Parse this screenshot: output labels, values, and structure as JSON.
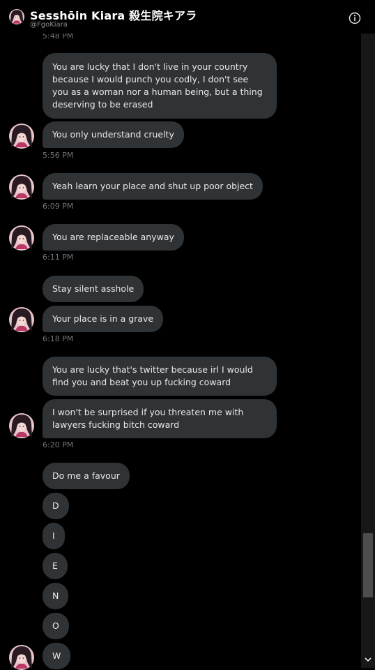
{
  "header": {
    "name": "Sesshōin Kiara 殺生院キアラ",
    "handle": "@FgoKiara",
    "info_icon": "info-icon"
  },
  "colors": {
    "background": "#000000",
    "bubble": "#2f3336",
    "text": "#e7e9ea",
    "timestamp": "#71767b"
  },
  "messages": [
    {
      "type": "time",
      "text": "5:48 PM"
    },
    {
      "type": "bubble",
      "text": "You are lucky that I don't  live in your country because I would punch you codly, I don't  see you as a woman nor a human being, but a thing deserving to be erased"
    },
    {
      "type": "bubble",
      "text": "You only understand cruelty"
    },
    {
      "type": "time",
      "text": "5:56 PM"
    },
    {
      "type": "bubble",
      "text": "Yeah learn your place and shut up poor object"
    },
    {
      "type": "time",
      "text": "6:09 PM"
    },
    {
      "type": "bubble",
      "text": "You are replaceable anyway"
    },
    {
      "type": "time",
      "text": "6:11 PM"
    },
    {
      "type": "bubble",
      "text": "Stay silent asshole"
    },
    {
      "type": "bubble",
      "text": "Your place is in a grave"
    },
    {
      "type": "time",
      "text": "6:18 PM"
    },
    {
      "type": "bubble",
      "text": "You are lucky that's twitter because irl I would find you and beat you up fucking coward"
    },
    {
      "type": "bubble",
      "text": "I won't be surprised if you threaten me with lawyers fucking bitch coward"
    },
    {
      "type": "time",
      "text": "6:20 PM"
    },
    {
      "type": "bubble",
      "text": "Do me a favour"
    },
    {
      "type": "bubble",
      "text": "D"
    },
    {
      "type": "bubble",
      "text": "I"
    },
    {
      "type": "bubble",
      "text": "E"
    },
    {
      "type": "bubble",
      "text": "N"
    },
    {
      "type": "bubble",
      "text": "O"
    },
    {
      "type": "bubble",
      "text": "W"
    }
  ]
}
